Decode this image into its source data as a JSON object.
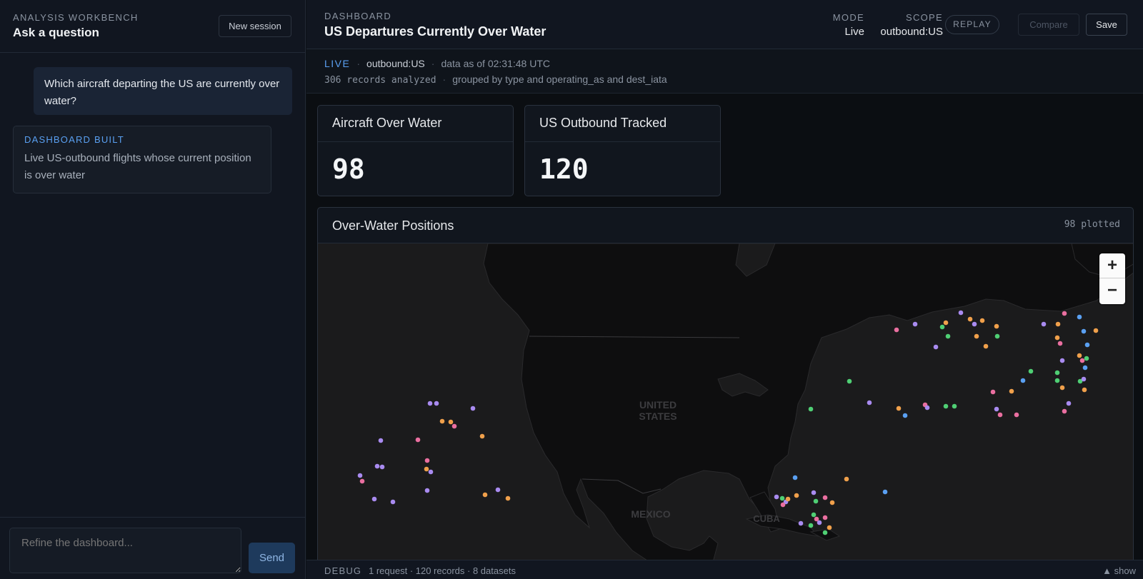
{
  "left_panel": {
    "eyebrow": "ANALYSIS WORKBENCH",
    "title": "Ask a question",
    "new_session_label": "New session",
    "user_message": "Which aircraft departing the US are currently over water?",
    "assistant_card": {
      "label": "DASHBOARD BUILT",
      "description": "Live US-outbound flights whose current position is over water"
    },
    "input_placeholder": "Refine the dashboard...",
    "send_label": "Send"
  },
  "header": {
    "eyebrow": "DASHBOARD",
    "title": "US Departures Currently Over Water",
    "mode_label": "MODE",
    "mode_value": "Live",
    "scope_label": "SCOPE",
    "scope_value": "outbound:US",
    "replay_label": "REPLAY",
    "compare_label": "Compare",
    "save_label": "Save"
  },
  "status": {
    "live": "LIVE",
    "scope": "outbound:US",
    "as_of": "data as of 02:31:48 UTC",
    "records": "306 records analyzed",
    "grouped": "grouped by type and operating_as and dest_iata",
    "separator": "·"
  },
  "kpis": [
    {
      "title": "Aircraft Over Water",
      "value": "98"
    },
    {
      "title": "US Outbound Tracked",
      "value": "120"
    }
  ],
  "map": {
    "title": "Over-Water Positions",
    "plotted": "98 plotted",
    "labels": [
      "UNITED",
      "STATES",
      "MEXICO",
      "CUBA"
    ],
    "zoom_in": "+",
    "zoom_out": "−",
    "point_colors": {
      "purple": "#a98bf0",
      "orange": "#f0a04b",
      "pink": "#ea6fa0",
      "green": "#4fcf74",
      "blue": "#5aa0f2"
    }
  },
  "debug": {
    "label": "DEBUG",
    "summary": "1 request · 120 records · 8 datasets",
    "toggle": "▲ show"
  }
}
